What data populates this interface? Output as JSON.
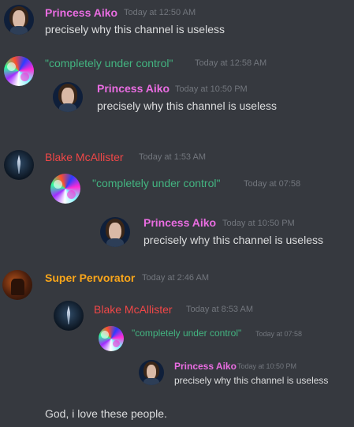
{
  "messages": [
    {
      "author": "Princess Aiko",
      "timestamp": "Today at 12:50 AM",
      "text": "precisely why this channel is useless"
    },
    {
      "author": "\"completely under control\"",
      "timestamp": "Today at 12:58 AM",
      "quote": {
        "author": "Princess Aiko",
        "timestamp": "Today at 10:50 PM",
        "text": "precisely why this channel is useless"
      }
    },
    {
      "author": "Blake McAllister",
      "timestamp": "Today at 1:53 AM",
      "quote": {
        "author": "\"completely under control\"",
        "timestamp": "Today at 07:58",
        "quote": {
          "author": "Princess Aiko",
          "timestamp": "Today at 10:50 PM",
          "text": "precisely why this channel is useless"
        }
      }
    },
    {
      "author": "Super Pervorator",
      "timestamp": "Today at 2:46 AM",
      "quote": {
        "author": "Blake McAllister",
        "timestamp": "Today at 8:53 AM",
        "quote": {
          "author": "\"completely under control\"",
          "timestamp": "Today at 07:58",
          "quote": {
            "author": "Princess Aiko",
            "timestamp": "Today at 10:50 PM",
            "text": "precisely why this channel is useless"
          }
        }
      },
      "text": "God, i love these people."
    }
  ],
  "colors": {
    "background": "#36393f",
    "text": "#dcddde",
    "timestamp": "#72767d",
    "princess_aiko": "#ea6de2",
    "completely_under_control": "#43b581",
    "blake_mcallister": "#f04747",
    "super_pervorator": "#faa61a"
  },
  "avatars": {
    "princess_aiko": "anime-girl-avatar",
    "completely_under_control": "glitch-art-avatar",
    "blake_mcallister": "blade-avatar",
    "super_pervorator": "fire-avatar"
  }
}
